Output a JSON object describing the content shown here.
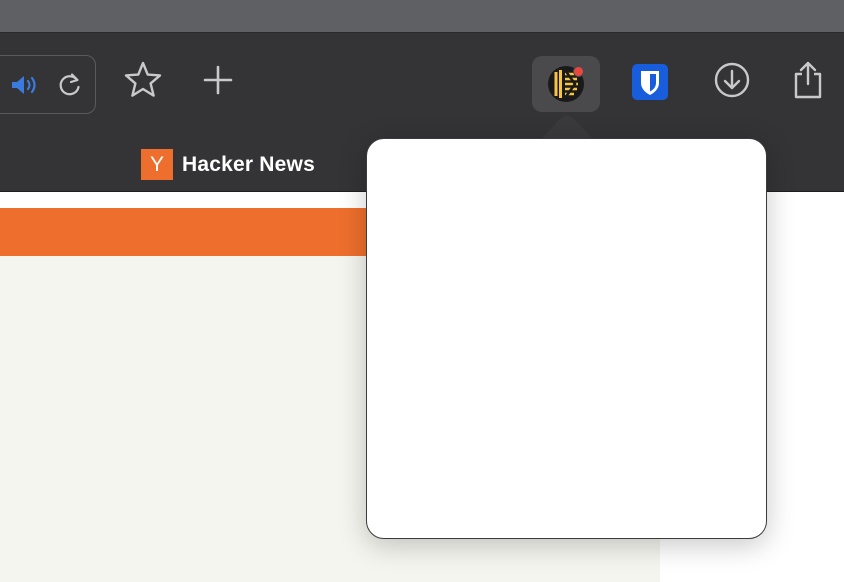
{
  "window": {
    "title_bar": "",
    "accent_color": "#ee6f2d"
  },
  "toolbar": {
    "address_field_icons": [
      "speaker-icon",
      "reload-icon"
    ],
    "buttons": [
      {
        "name": "bookmark-star-icon"
      },
      {
        "name": "new-tab-plus-icon"
      },
      {
        "name": "keeper-extension-icon",
        "active": true,
        "badge_color": "#e8483f"
      },
      {
        "name": "bitwarden-extension-icon",
        "color": "#175ddc"
      },
      {
        "name": "downloads-icon"
      },
      {
        "name": "share-icon"
      }
    ]
  },
  "bookmarks_bar": {
    "items": [
      {
        "logo_text": "Y",
        "label": "Hacker News"
      }
    ]
  },
  "content": {
    "header_color": "#ee6f2d",
    "body_color": "#f5f5ef"
  },
  "popover": {
    "source": "keeper-extension-icon",
    "content": ""
  }
}
